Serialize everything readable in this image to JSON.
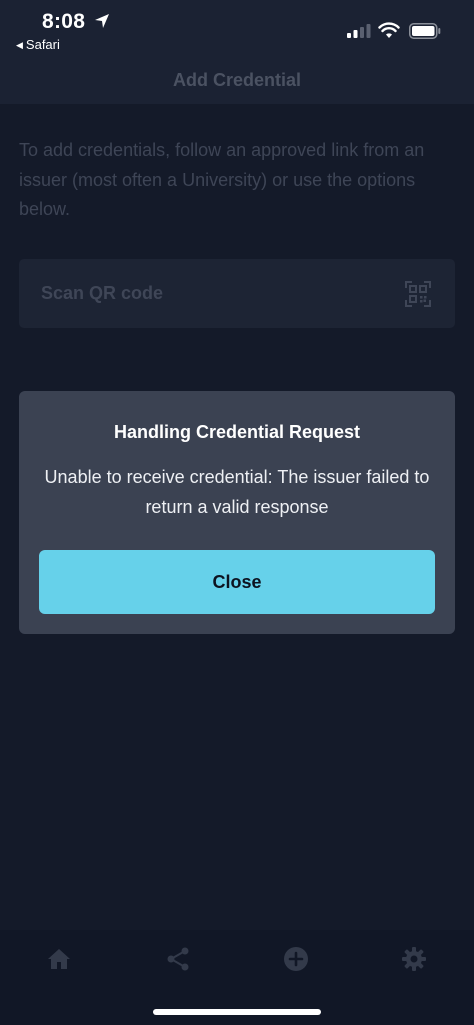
{
  "status_bar": {
    "time": "8:08",
    "back_app": "Safari"
  },
  "header": {
    "title": "Add Credential"
  },
  "main": {
    "intro": "To add credentials, follow an approved link from an issuer (most often a University) or use the options below.",
    "scan_label": "Scan QR code"
  },
  "modal": {
    "title": "Handling Credential Request",
    "message": "Unable to receive credential: The issuer failed to return a valid response",
    "close_label": "Close"
  },
  "tabs": [
    {
      "icon": "home-icon"
    },
    {
      "icon": "share-icon"
    },
    {
      "icon": "add-circle-icon"
    },
    {
      "icon": "gear-icon"
    }
  ],
  "colors": {
    "background": "#141a29",
    "modal": "#3b4252",
    "accent": "#66d1ea"
  }
}
